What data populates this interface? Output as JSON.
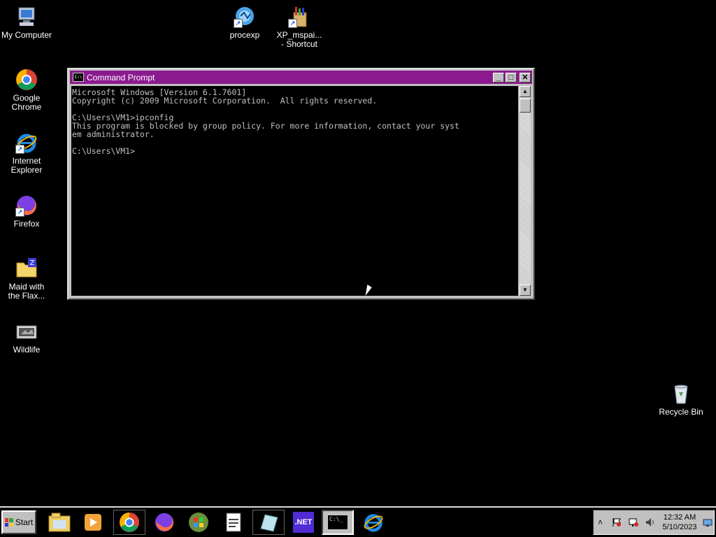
{
  "desktop": {
    "icons": [
      {
        "label": "My Computer",
        "icon": "computer-icon"
      },
      {
        "label": "procexp",
        "icon": "procexp-shortcut-icon"
      },
      {
        "label": "XP_mspai...\n- Shortcut",
        "icon": "paint-shortcut-icon"
      },
      {
        "label": "Google\nChrome",
        "icon": "chrome-icon"
      },
      {
        "label": "Internet\nExplorer",
        "icon": "ie-icon"
      },
      {
        "label": "Firefox",
        "icon": "firefox-icon"
      },
      {
        "label": "Maid with\nthe Flax...",
        "icon": "zip-folder-icon"
      },
      {
        "label": "Wildlife",
        "icon": "video-icon"
      },
      {
        "label": "Recycle Bin",
        "icon": "recycle-bin-icon"
      }
    ]
  },
  "cmd": {
    "title": "Command Prompt",
    "minimize": "_",
    "maximize": "□",
    "close": "✕",
    "icon_text": "C:\\",
    "lines": [
      "Microsoft Windows [Version 6.1.7601]",
      "Copyright (c) 2009 Microsoft Corporation.  All rights reserved.",
      "",
      "C:\\Users\\VM1>ipconfig",
      "This program is blocked by group policy. For more information, contact your syst",
      "em administrator.",
      "",
      "C:\\Users\\VM1>"
    ]
  },
  "taskbar": {
    "start_label": "Start",
    "items": [
      {
        "name": "explorer-icon"
      },
      {
        "name": "media-player-icon"
      },
      {
        "name": "chrome-icon"
      },
      {
        "name": "firefox-icon"
      },
      {
        "name": "windows-orb-icon"
      },
      {
        "name": "notepad-icon"
      },
      {
        "name": "paint-icon"
      },
      {
        "name": "dotnet-icon",
        "text": ".NET"
      },
      {
        "name": "cmd-icon",
        "text": "C:\\_",
        "active": true
      },
      {
        "name": "ie-icon"
      }
    ],
    "tray": {
      "show_hidden": "˄",
      "time": "12:32 AM",
      "date": "5/10/2023"
    }
  },
  "colors": {
    "titlebar": "#8b1a8f",
    "desktop": "#000000",
    "chrome_red": "#db4437",
    "chrome_green": "#0f9d58",
    "chrome_yellow": "#f4b400",
    "chrome_blue": "#4285f4",
    "ie_blue": "#1e88e5",
    "firefox_orange": "#ff7139"
  }
}
